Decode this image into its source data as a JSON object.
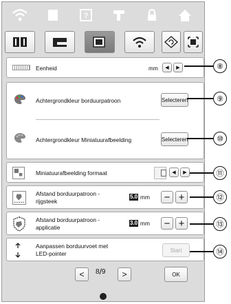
{
  "categories": [
    {
      "name": "wifi-icon"
    },
    {
      "name": "document-icon"
    },
    {
      "name": "help-icon"
    },
    {
      "name": "machine-icon"
    },
    {
      "name": "lock-icon"
    },
    {
      "name": "home-icon"
    }
  ],
  "subtabs": [
    {
      "name": "book-icon",
      "active": false
    },
    {
      "name": "sewing-machine-icon",
      "active": false
    },
    {
      "name": "embroidery-frame-icon",
      "active": true
    },
    {
      "name": "wifi-icon",
      "active": false
    }
  ],
  "unit": {
    "label": "Eenheid",
    "value": "mm"
  },
  "bg_pattern": {
    "label": "Achtergrondkleur borduurpatroon",
    "button": "Selecteren"
  },
  "bg_thumbnail": {
    "label": "Achtergrondkleur Miniatuurafbeelding",
    "button": "Selecteren"
  },
  "thumbnail_size": {
    "label": "Miniatuurafbeelding formaat"
  },
  "distance_running": {
    "label_line1": "Afstand borduurpatroon -",
    "label_line2": "rijgsteek",
    "value": "5.0",
    "unit": "mm"
  },
  "distance_applique": {
    "label_line1": "Afstand borduurpatroon -",
    "label_line2": "applicatie",
    "value": "3.0",
    "unit": "mm"
  },
  "led_pointer": {
    "label_line1": "Aanpassen borduurvoet met",
    "label_line2": "LED-pointer",
    "button": "Start"
  },
  "pager": {
    "current": "8",
    "total": "9"
  },
  "ok_button": "OK",
  "callouts": [
    "⑧",
    "⑨",
    "⑩",
    "⑪",
    "⑫",
    "⑬",
    "⑭"
  ],
  "colors": {
    "frame": "#dcdcdc",
    "panel": "#ffffff",
    "value_box": "#1a1a1a"
  }
}
